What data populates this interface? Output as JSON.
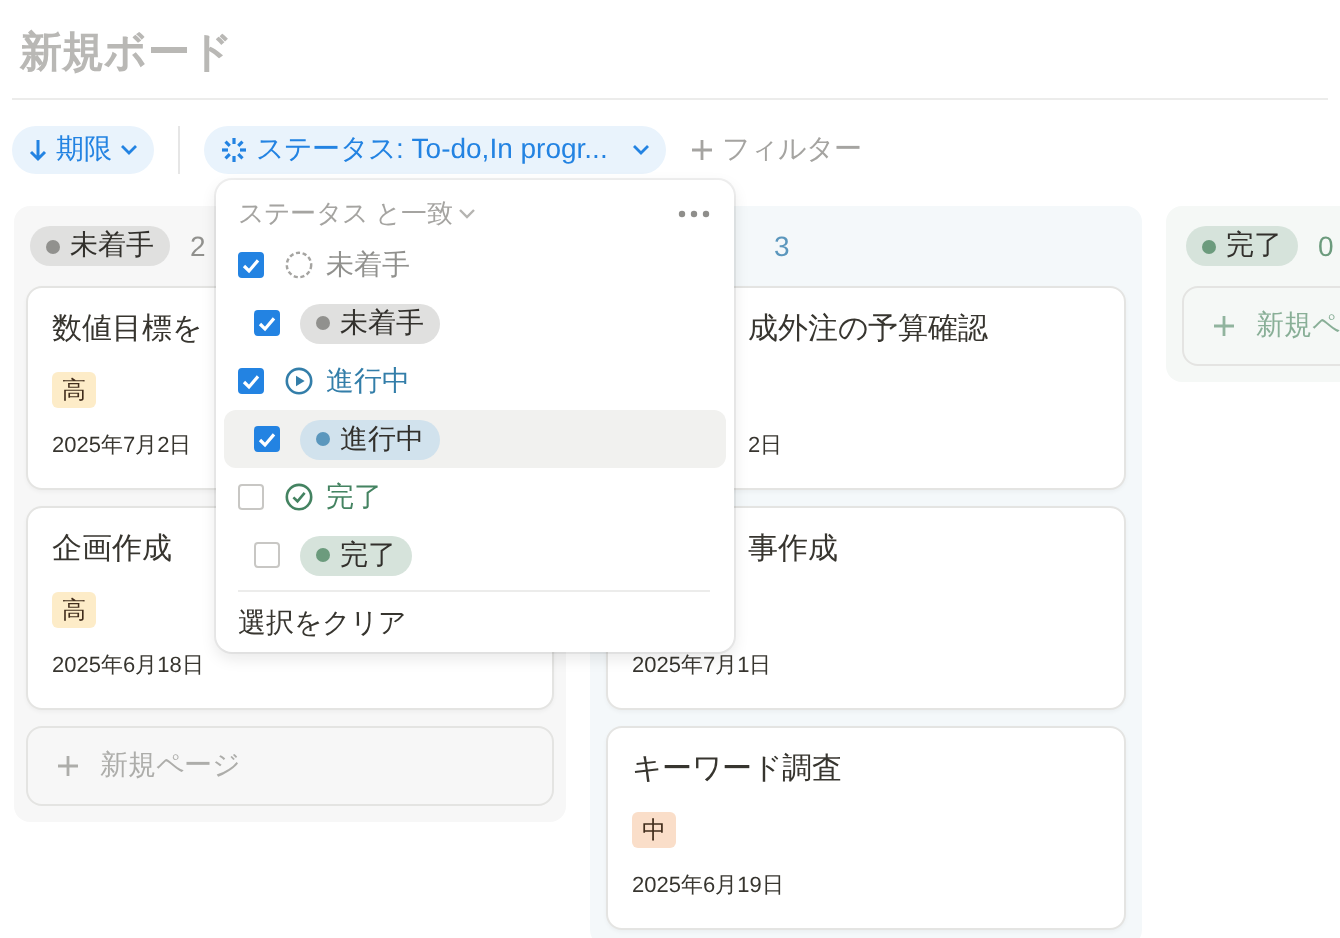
{
  "title": "新規ボード",
  "toolbar": {
    "sort": {
      "label": "期限"
    },
    "filter": {
      "label": "ステータス: To-do,In progr..."
    },
    "add_filter": {
      "label": "フィルター"
    }
  },
  "columns": [
    {
      "color": "#91918e",
      "tag": "未着手",
      "count": "2",
      "cards": [
        {
          "title": "数値目標を",
          "priority": {
            "label": "高",
            "color": "#fdecc8"
          },
          "date": "2025年7月2日"
        },
        {
          "title": "企画作成",
          "priority": {
            "label": "高",
            "color": "#fdecc8"
          },
          "date": "2025年6月18日"
        }
      ],
      "new_page": "新規ページ"
    },
    {
      "color": "#5b97bd",
      "count": "3",
      "cards": [
        {
          "title": "成外注の予算確認",
          "date": "2日",
          "title_cut": true,
          "date_cut": true
        },
        {
          "title": "事作成",
          "date": "2025年7月1日",
          "title_cut": true
        },
        {
          "title": "キーワード調査",
          "priority": {
            "label": "中",
            "color": "#fadec9"
          },
          "date": "2025年6月19日"
        }
      ]
    },
    {
      "color": "#6c9b7d",
      "tag": "完了",
      "count": "0",
      "new_page": "新規ペ"
    }
  ],
  "dropdown": {
    "header": "ステータス と一致",
    "rows": [
      {
        "kind": "group",
        "label": "未着手",
        "color": "#91918e",
        "checked": true,
        "highlighted": false
      },
      {
        "kind": "option",
        "label": "未着手",
        "color": "#91918e",
        "checked": true,
        "highlighted": false
      },
      {
        "kind": "group",
        "label": "進行中",
        "color": "#337ea9",
        "checked": true,
        "highlighted": false
      },
      {
        "kind": "option",
        "label": "進行中",
        "color": "#5b97bd",
        "checked": true,
        "highlighted": true
      },
      {
        "kind": "group",
        "label": "完了",
        "color": "#448361",
        "checked": false,
        "highlighted": false
      },
      {
        "kind": "option",
        "label": "完了",
        "color": "#6c9b7d",
        "checked": false,
        "highlighted": false
      }
    ],
    "clear": "選択をクリア"
  }
}
